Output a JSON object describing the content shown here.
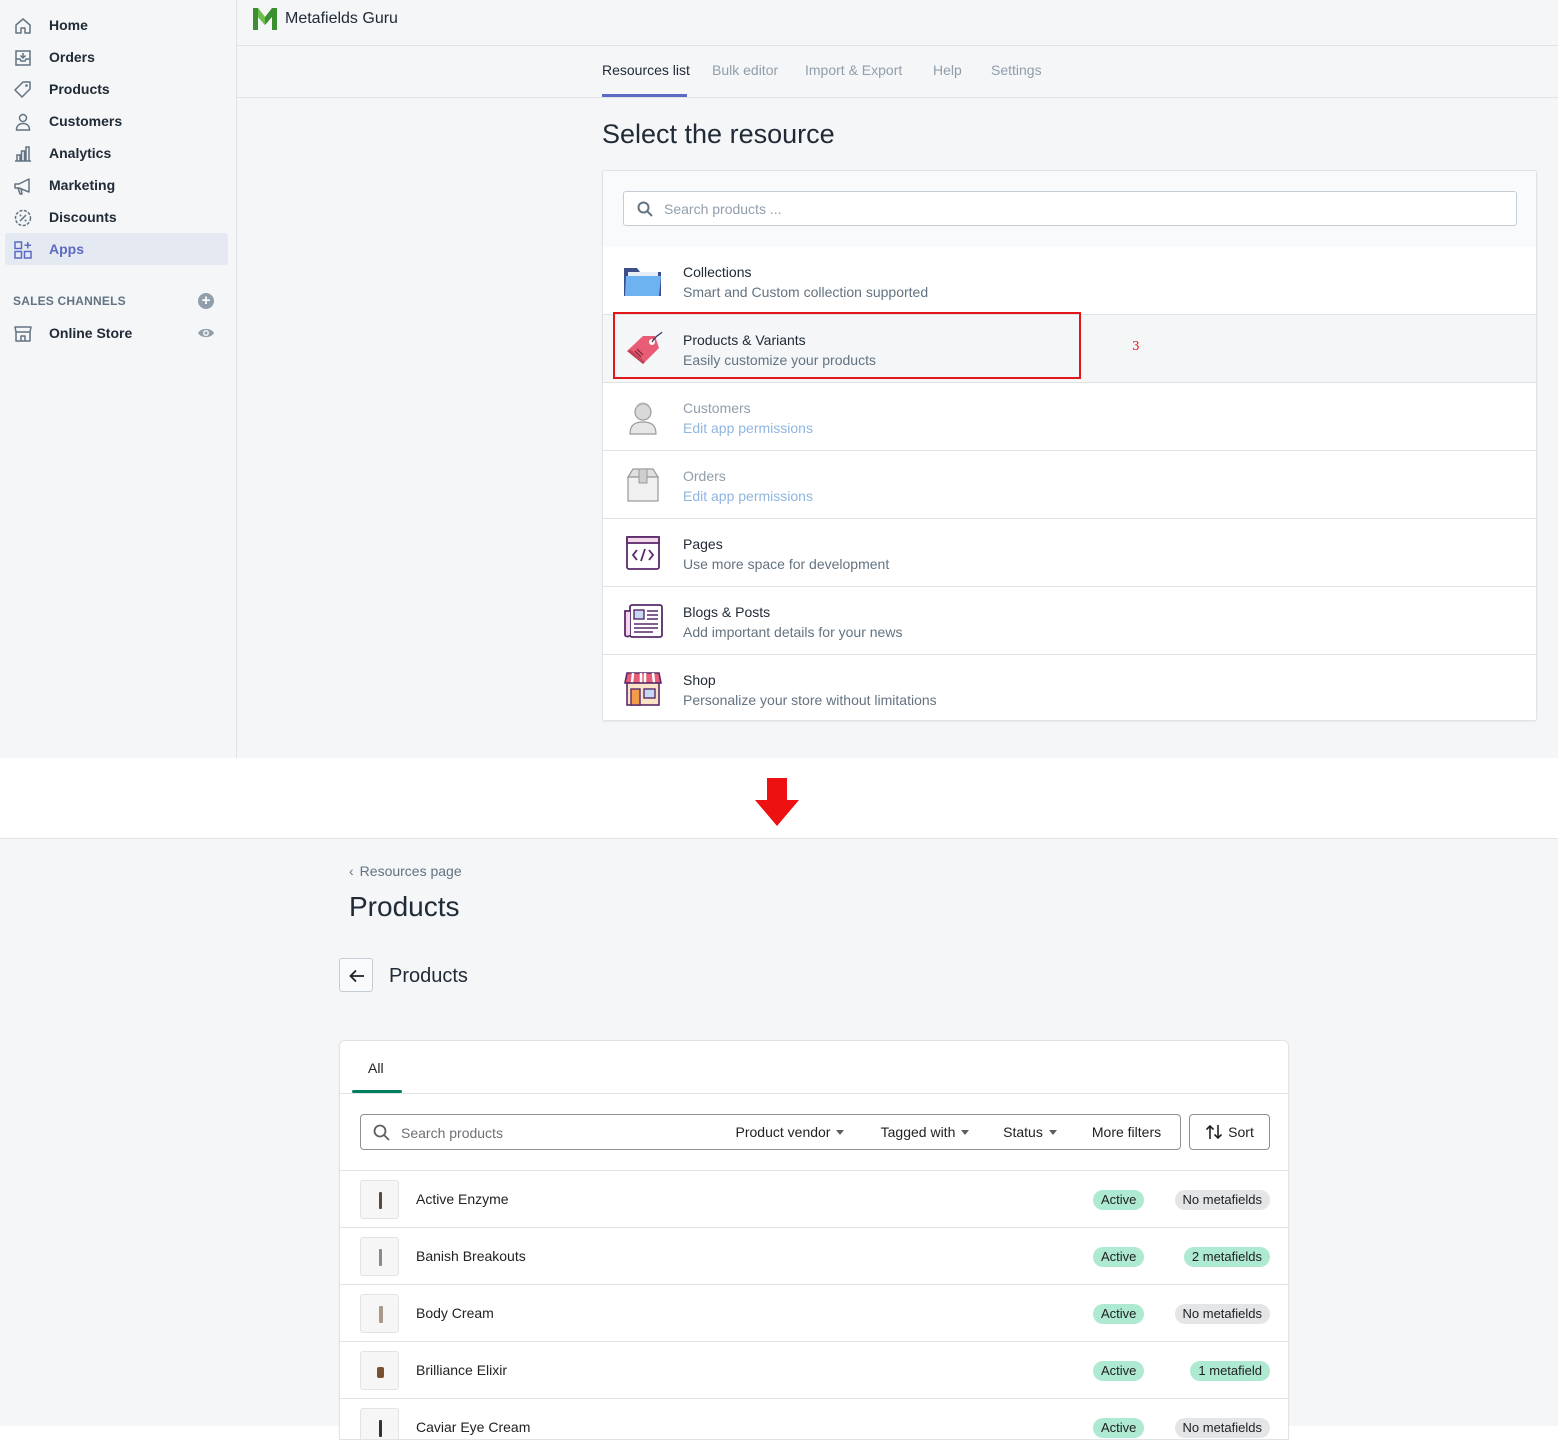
{
  "sidebar": {
    "items": [
      {
        "label": "Home",
        "icon": "home-icon"
      },
      {
        "label": "Orders",
        "icon": "orders-icon"
      },
      {
        "label": "Products",
        "icon": "tag-icon"
      },
      {
        "label": "Customers",
        "icon": "person-icon"
      },
      {
        "label": "Analytics",
        "icon": "bar-chart-icon"
      },
      {
        "label": "Marketing",
        "icon": "megaphone-icon"
      },
      {
        "label": "Discounts",
        "icon": "discount-icon"
      },
      {
        "label": "Apps",
        "icon": "apps-icon",
        "active": true
      }
    ],
    "sales_channels_label": "SALES CHANNELS",
    "online_store_label": "Online Store"
  },
  "app": {
    "title": "Metafields Guru",
    "tabs": [
      {
        "label": "Resources list",
        "active": true
      },
      {
        "label": "Bulk editor"
      },
      {
        "label": "Import & Export"
      },
      {
        "label": "Help"
      },
      {
        "label": "Settings"
      }
    ]
  },
  "resources": {
    "heading": "Select the resource",
    "search_placeholder": "Search products ...",
    "rows": [
      {
        "title": "Collections",
        "subtitle": "Smart and Custom collection supported",
        "icon": "folder-icon"
      },
      {
        "title": "Products & Variants",
        "subtitle": "Easily customize your products",
        "icon": "price-tag-icon"
      },
      {
        "title": "Customers",
        "subtitle": "Edit app permissions",
        "icon": "customer-avatar-icon",
        "disabled": true
      },
      {
        "title": "Orders",
        "subtitle": "Edit app permissions",
        "icon": "box-icon",
        "disabled": true
      },
      {
        "title": "Pages",
        "subtitle": "Use more space for development",
        "icon": "code-window-icon"
      },
      {
        "title": "Blogs & Posts",
        "subtitle": "Add important details for your news",
        "icon": "newspaper-icon"
      },
      {
        "title": "Shop",
        "subtitle": "Personalize your store without limitations",
        "icon": "storefront-icon"
      }
    ],
    "annotation_number": "3"
  },
  "products_page": {
    "breadcrumb": "Resources page",
    "title": "Products",
    "subtitle": "Products",
    "tab_all": "All",
    "search_placeholder": "Search products",
    "filters": [
      "Product vendor",
      "Tagged with",
      "Status",
      "More filters"
    ],
    "sort_label": "Sort",
    "products": [
      {
        "name": "Active Enzyme",
        "status": "Active",
        "metafields": "No metafields",
        "has_meta": false
      },
      {
        "name": "Banish Breakouts",
        "status": "Active",
        "metafields": "2 metafields",
        "has_meta": true
      },
      {
        "name": "Body Cream",
        "status": "Active",
        "metafields": "No metafields",
        "has_meta": false
      },
      {
        "name": "Brilliance Elixir",
        "status": "Active",
        "metafields": "1 metafield",
        "has_meta": true
      },
      {
        "name": "Caviar Eye Cream",
        "status": "Active",
        "metafields": "No metafields",
        "has_meta": false
      }
    ]
  },
  "colors": {
    "accent": "#5c6ac4",
    "highlight": "#e0161b",
    "success_badge": "#aee9d1",
    "neutral_badge": "#e4e5e7",
    "tab_active": "#008060"
  }
}
